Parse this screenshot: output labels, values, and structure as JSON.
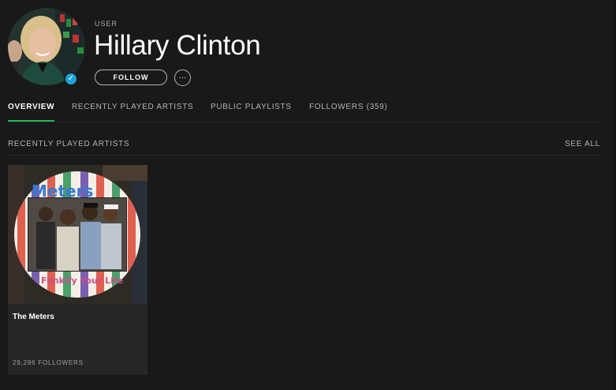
{
  "profile": {
    "type_label": "USER",
    "name": "Hillary Clinton",
    "verified_icon": "verified-check-icon",
    "follow_label": "FOLLOW",
    "more_label": "···"
  },
  "tabs": [
    {
      "label": "OVERVIEW",
      "active": true
    },
    {
      "label": "RECENTLY PLAYED ARTISTS",
      "active": false
    },
    {
      "label": "PUBLIC PLAYLISTS",
      "active": false
    },
    {
      "label": "FOLLOWERS (359)",
      "active": false
    }
  ],
  "section": {
    "title": "RECENTLY PLAYED ARTISTS",
    "see_all_label": "SEE ALL"
  },
  "artists": [
    {
      "name": "The Meters",
      "followers": "29,286 FOLLOWERS",
      "album_art_title": "Meters",
      "album_art_subtitle": "Funkify Your Life"
    }
  ],
  "colors": {
    "background": "#19191a",
    "accent": "#1db954",
    "verified": "#1ea2d8",
    "card": "#262626"
  }
}
